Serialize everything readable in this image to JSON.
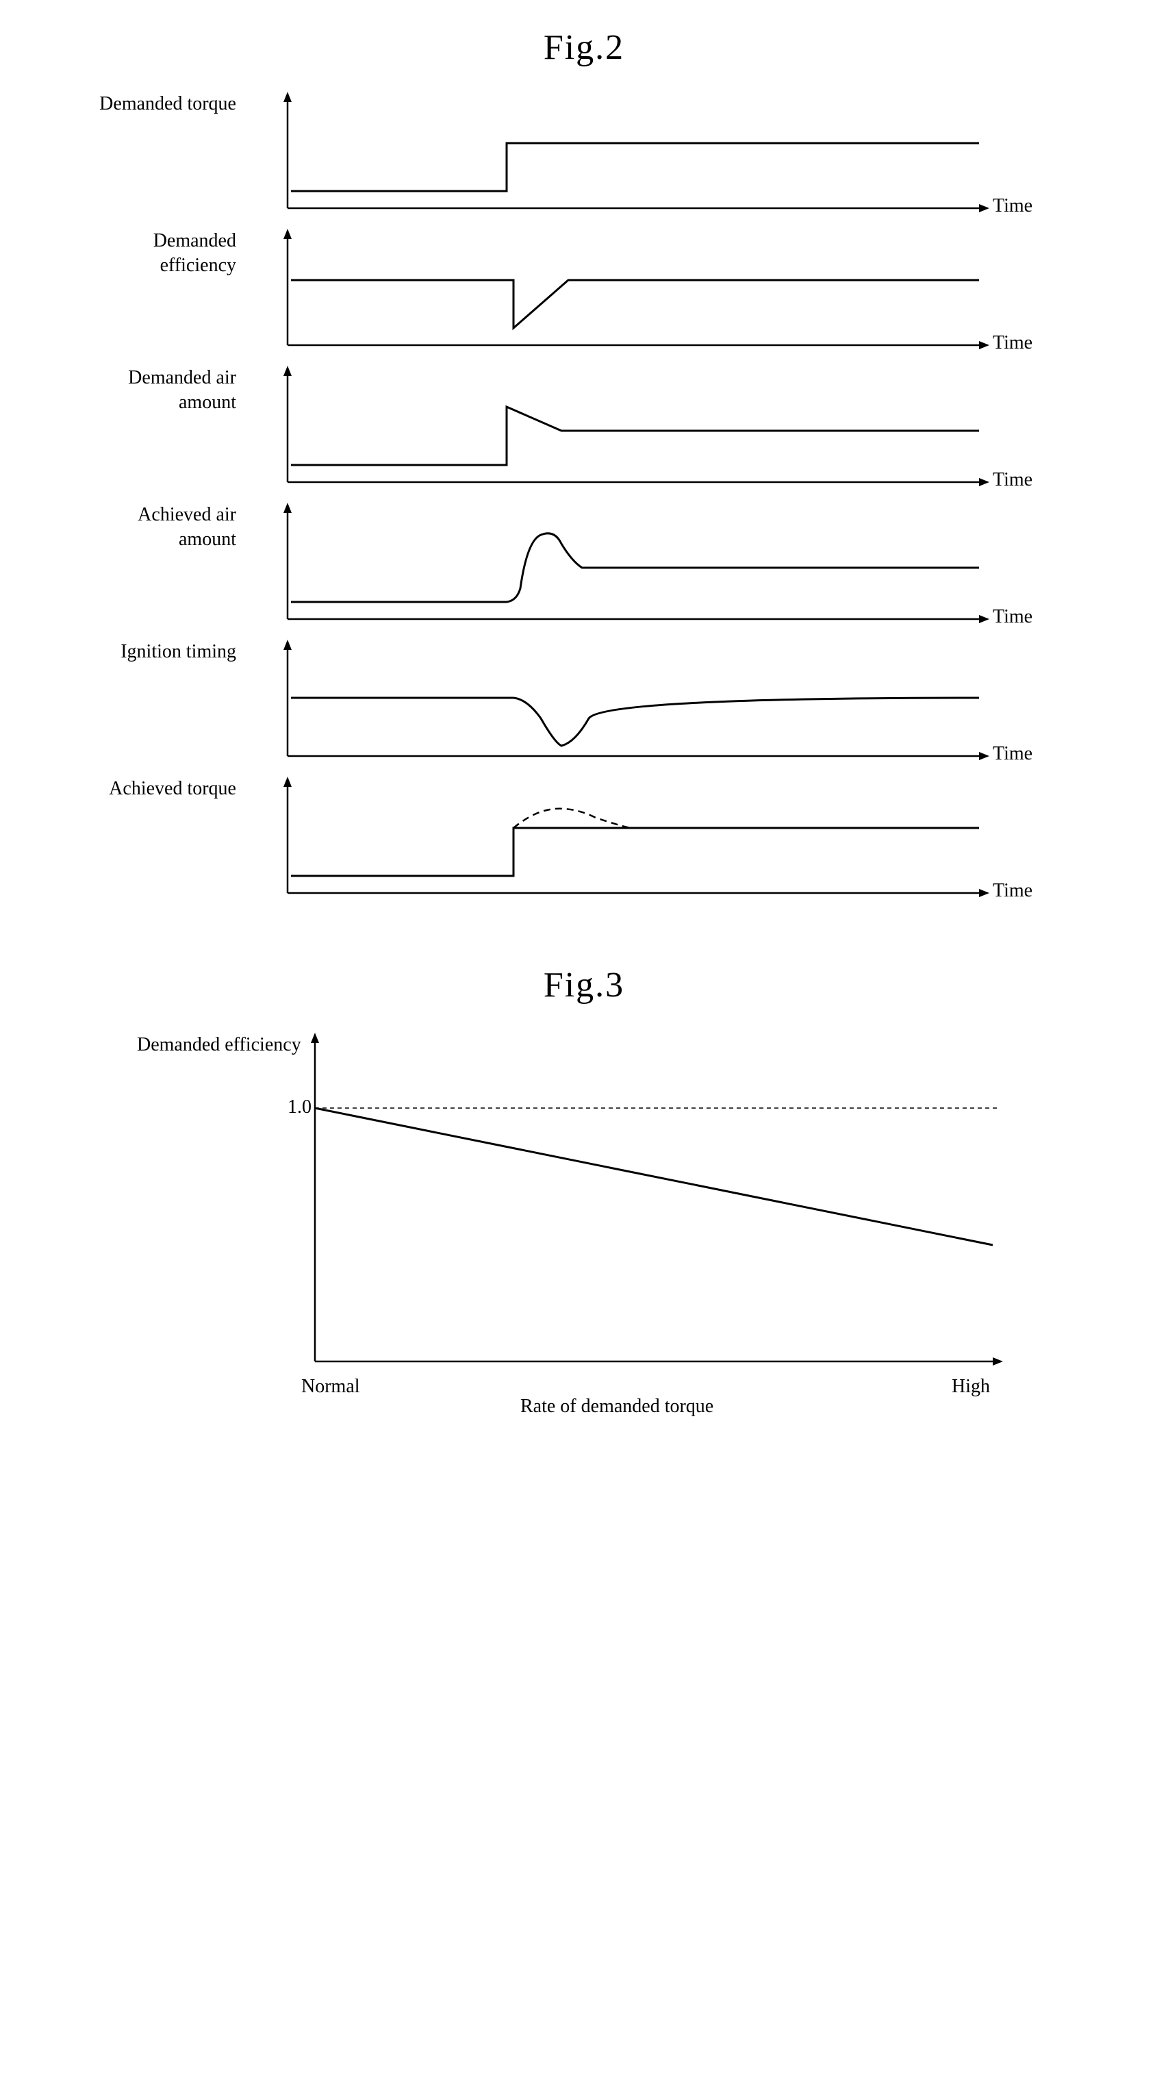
{
  "fig2": {
    "title": "Fig.2",
    "charts": [
      {
        "id": "demanded-torque",
        "label": "Demanded torque",
        "type": "step_up"
      },
      {
        "id": "demanded-efficiency",
        "label": "Demanded efficiency",
        "type": "step_down_recover"
      },
      {
        "id": "demanded-air-amount",
        "label": "Demanded air amount",
        "type": "step_up_drop"
      },
      {
        "id": "achieved-air-amount",
        "label": "Achieved air amount",
        "type": "overshoot_up"
      },
      {
        "id": "ignition-timing",
        "label": "Ignition timing",
        "type": "dip_down"
      },
      {
        "id": "achieved-torque",
        "label": "Achieved torque",
        "type": "step_up_dashed"
      }
    ],
    "time_label": "Time"
  },
  "fig3": {
    "title": "Fig.3",
    "y_label": "Demanded efficiency",
    "x_label": "Rate of demanded torque",
    "y_value": "1.0",
    "x_normal": "Normal",
    "x_high": "High"
  }
}
